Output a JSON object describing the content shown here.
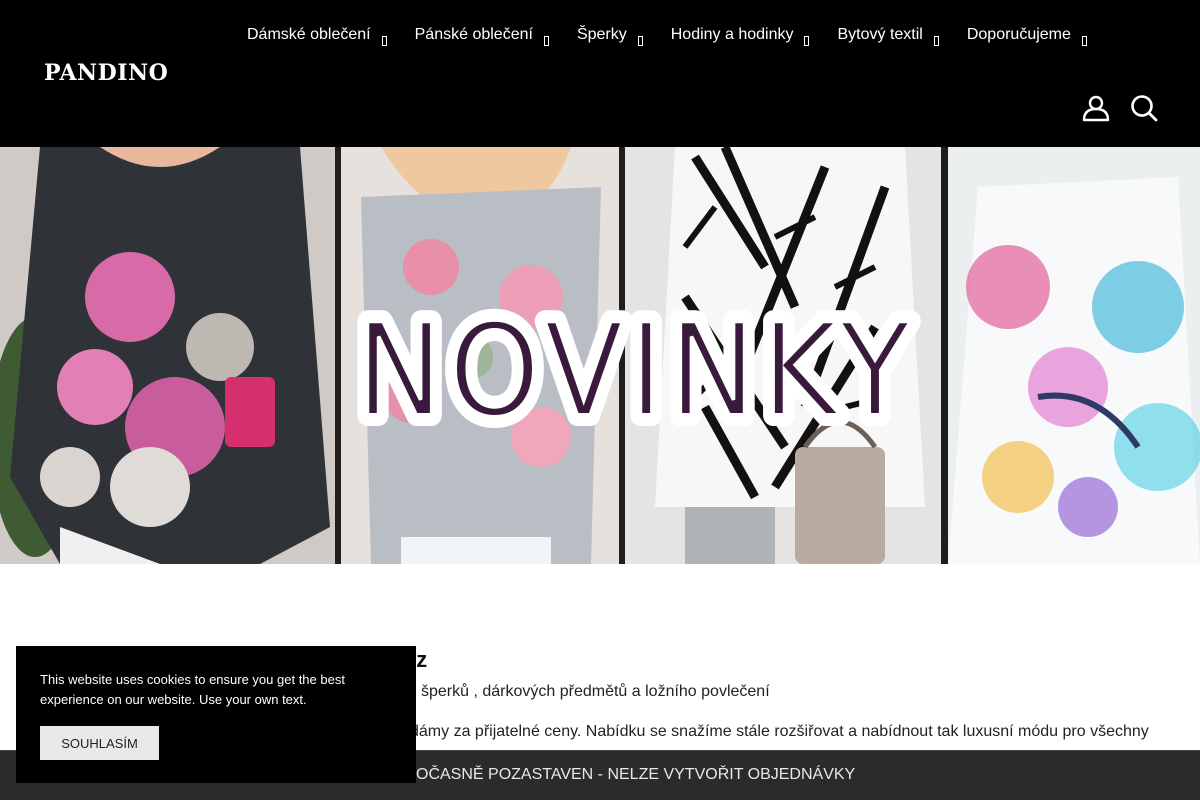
{
  "header": {
    "logo": "PANDINO",
    "nav": [
      {
        "label": "Dámské oblečení"
      },
      {
        "label": "Pánské oblečení"
      },
      {
        "label": "Šperky"
      },
      {
        "label": "Hodiny a hodinky"
      },
      {
        "label": "Bytový textil"
      },
      {
        "label": "Doporučujeme"
      }
    ],
    "icons": [
      "user-account-icon",
      "search-icon"
    ]
  },
  "banner": {
    "title": "NOVINKY",
    "title_color": "#3a1a3c"
  },
  "content": {
    "heading": "cz",
    "line1": "šperků , dárkových předmětů a ložního povlečení",
    "line2": "dámy za přijatelné ceny. Nabídku se snažíme stále rozšiřovat a nabídnout tak luxusní módu pro všechny"
  },
  "notice": {
    "text": "OČASNĚ POZASTAVEN - NELZE VYTVOŘIT OBJEDNÁVKY"
  },
  "cookie": {
    "text": "This website uses cookies to ensure you get the best experience on our website. Use your own text.",
    "button": "SOUHLASÍM"
  },
  "colors": {
    "header_bg": "#000000",
    "notice_bg": "#2b2b2b",
    "cookie_bg": "#000000",
    "accent_pink": "#e0459b"
  }
}
